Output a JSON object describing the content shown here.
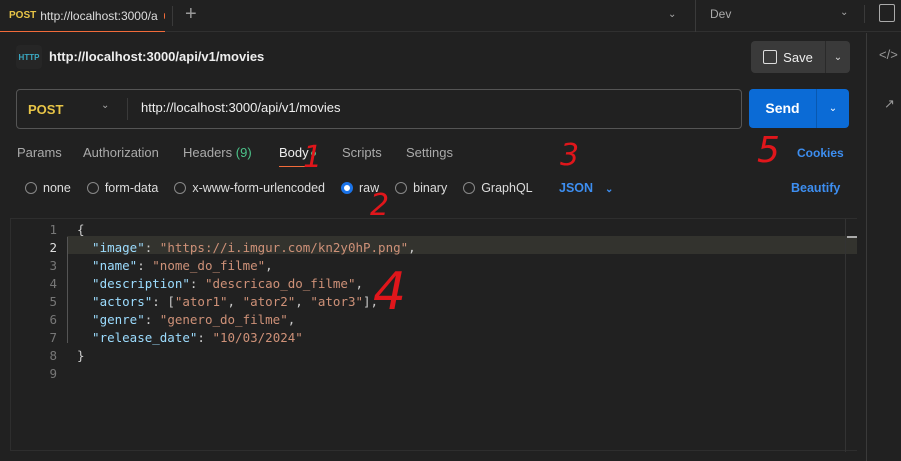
{
  "top_tab": {
    "method": "POST",
    "title": "http://localhost:3000/a",
    "new_tab": "+"
  },
  "environment": "Dev",
  "request": {
    "name": "http://localhost:3000/api/v1/movies",
    "method": "POST",
    "url": "http://localhost:3000/api/v1/movies",
    "http_badge": "HTTP"
  },
  "buttons": {
    "save": "Save",
    "send": "Send",
    "cookies": "Cookies",
    "beautify": "Beautify"
  },
  "tabs": [
    {
      "label": "Params"
    },
    {
      "label": "Authorization"
    },
    {
      "label": "Headers",
      "count": "(9)"
    },
    {
      "label": "Body"
    },
    {
      "label": "Scripts"
    },
    {
      "label": "Settings"
    }
  ],
  "body_types": [
    "none",
    "form-data",
    "x-www-form-urlencoded",
    "raw",
    "binary",
    "GraphQL"
  ],
  "selected_body_type": "raw",
  "format": "JSON",
  "code_lines": [
    [
      [
        "p",
        "{"
      ]
    ],
    [
      [
        "k",
        "  \"image\""
      ],
      [
        "p",
        ": "
      ],
      [
        "s",
        "\"https://i.imgur.com/kn2y0hP.png\""
      ],
      [
        "p",
        ","
      ]
    ],
    [
      [
        "k",
        "  \"name\""
      ],
      [
        "p",
        ": "
      ],
      [
        "s",
        "\"nome_do_filme\""
      ],
      [
        "p",
        ","
      ]
    ],
    [
      [
        "k",
        "  \"description\""
      ],
      [
        "p",
        ": "
      ],
      [
        "s",
        "\"descricao_do_filme\""
      ],
      [
        "p",
        ","
      ]
    ],
    [
      [
        "k",
        "  \"actors\""
      ],
      [
        "p",
        ": ["
      ],
      [
        "s",
        "\"ator1\""
      ],
      [
        "p",
        ", "
      ],
      [
        "s",
        "\"ator2\""
      ],
      [
        "p",
        ", "
      ],
      [
        "s",
        "\"ator3\""
      ],
      [
        "p",
        "],"
      ]
    ],
    [
      [
        "k",
        "  \"genre\""
      ],
      [
        "p",
        ": "
      ],
      [
        "s",
        "\"genero_do_filme\""
      ],
      [
        "p",
        ","
      ]
    ],
    [
      [
        "k",
        "  \"release_date\""
      ],
      [
        "p",
        ": "
      ],
      [
        "s",
        "\"10/03/2024\""
      ]
    ],
    [
      [
        "p",
        "}"
      ]
    ],
    [
      [
        "p",
        ""
      ]
    ]
  ],
  "annotations": [
    "1",
    "2",
    "3",
    "4",
    "5"
  ],
  "colors": {
    "accent": "#f26b3a",
    "send": "#0b6bd6",
    "link": "#3d8ef0",
    "method": "#e8c547"
  }
}
